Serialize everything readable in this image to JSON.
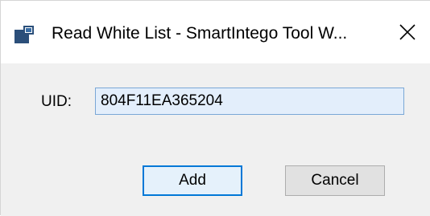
{
  "window": {
    "title": "Read White List - SmartIntego Tool W...",
    "icon": "app-window-icon",
    "close_icon": "close-icon"
  },
  "form": {
    "uid_label": "UID:",
    "uid_value": "804F11EA365204"
  },
  "buttons": {
    "add_label": "Add",
    "cancel_label": "Cancel"
  },
  "colors": {
    "focus_accent": "#0078d7",
    "input_background": "#e3eefb",
    "dialog_background": "#f0f0f0"
  }
}
